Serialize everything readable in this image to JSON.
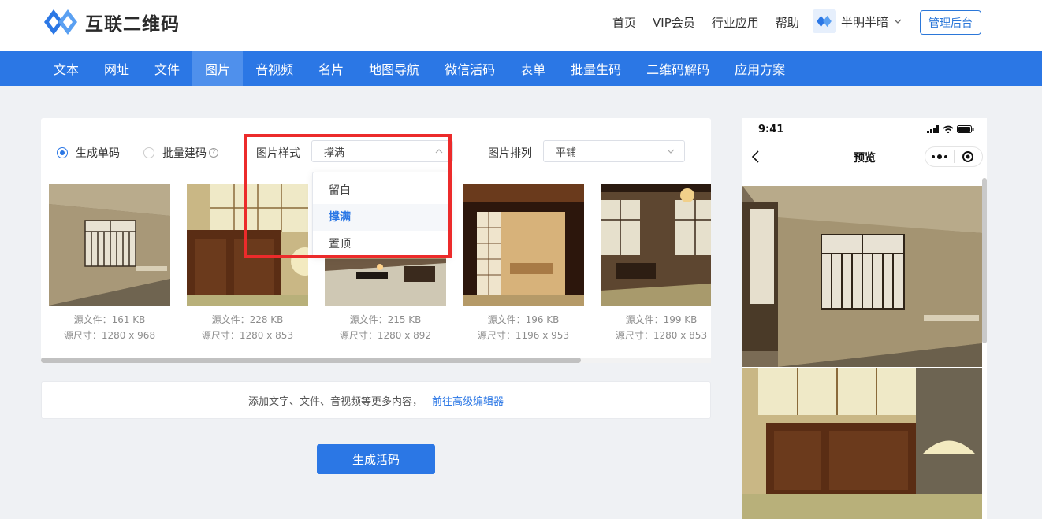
{
  "brand": {
    "name": "互联二维码"
  },
  "topnav": [
    "首页",
    "VIP会员",
    "行业应用",
    "帮助"
  ],
  "user": {
    "name": "半明半暗"
  },
  "admin_button": "管理后台",
  "tabs": [
    "文本",
    "网址",
    "文件",
    "图片",
    "音视频",
    "名片",
    "地图导航",
    "微信活码",
    "表单",
    "批量生码",
    "二维码解码",
    "应用方案"
  ],
  "active_tab": "图片",
  "options": {
    "single": "生成单码",
    "batch": "批量建码",
    "help_glyph": "?",
    "style_label": "图片样式",
    "style_value": "撑满",
    "arrange_label": "图片排列",
    "arrange_value": "平铺"
  },
  "dropdown": {
    "items": [
      "留白",
      "撑满",
      "置顶"
    ],
    "selected": "撑满"
  },
  "images": [
    {
      "size": "源文件：161 KB",
      "dims": "源尺寸：1280 x 968"
    },
    {
      "size": "源文件：228 KB",
      "dims": "源尺寸：1280 x 853"
    },
    {
      "size": "源文件：215 KB",
      "dims": "源尺寸：1280 x 892"
    },
    {
      "size": "源文件：196 KB",
      "dims": "源尺寸：1196 x 953"
    },
    {
      "size": "源文件：199 KB",
      "dims": "源尺寸：1280 x 853"
    }
  ],
  "info": {
    "text": "添加文字、文件、音视频等更多内容，",
    "link": "前往高级编辑器"
  },
  "generate_button": "生成活码",
  "phone": {
    "time": "9:41",
    "title": "预览"
  },
  "colors": {
    "primary": "#2b77e5",
    "highlight": "#ec2b2b"
  }
}
